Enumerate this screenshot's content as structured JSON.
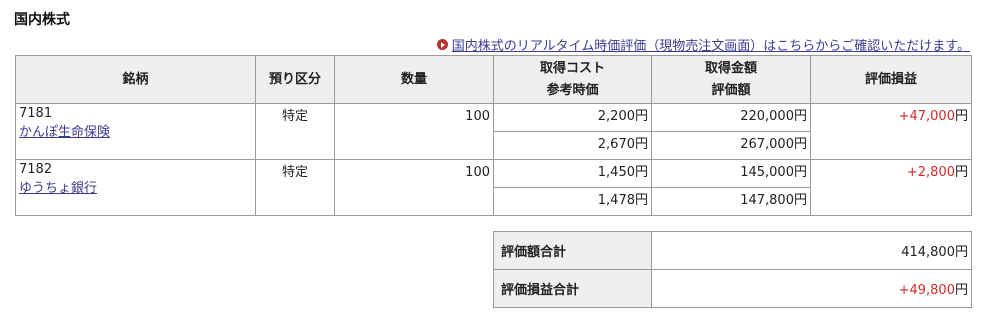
{
  "section": {
    "title": "国内株式"
  },
  "realtime_link": {
    "label": "国内株式のリアルタイム時価評価（現物売注文画面）はこちらからご確認いただけます。"
  },
  "table": {
    "headers": {
      "name": "銘柄",
      "account": "預り区分",
      "quantity": "数量",
      "cost_top": "取得コスト",
      "cost_bottom": "参考時価",
      "amount_top": "取得金額",
      "amount_bottom": "評価額",
      "pnl": "評価損益"
    },
    "yen_unit": "円",
    "rows": [
      {
        "code": "7181",
        "name": "かんぽ生命保険",
        "account": "特定",
        "quantity": "100",
        "cost": "2,200",
        "price": "2,670",
        "acquisition": "220,000",
        "valuation": "267,000",
        "pnl": "+47,000"
      },
      {
        "code": "7182",
        "name": "ゆうちょ銀行",
        "account": "特定",
        "quantity": "100",
        "cost": "1,450",
        "price": "1,478",
        "acquisition": "145,000",
        "valuation": "147,800",
        "pnl": "+2,800"
      }
    ]
  },
  "summary": {
    "valuation_label": "評価額合計",
    "valuation_value": "414,800",
    "pnl_label": "評価損益合計",
    "pnl_value": "+49,800"
  },
  "colors": {
    "profit": "#d22b2b",
    "link": "#3b3b93",
    "header_bg": "#efefef",
    "arrow_icon": "#b5342c"
  },
  "icons": {
    "realtime_link": "circle-arrow-icon"
  }
}
